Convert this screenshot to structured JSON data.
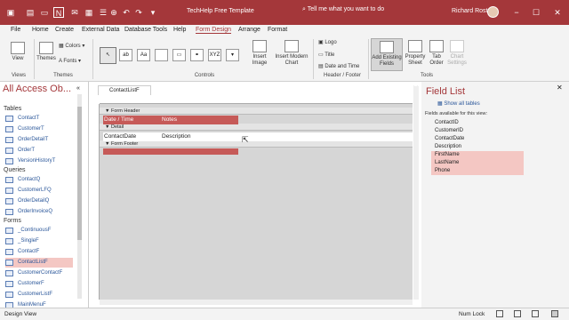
{
  "titlebar": {
    "title": "TechHelp Free Template",
    "search": "Tell me what you want to do",
    "user": "Richard Rost"
  },
  "menu": [
    "File",
    "Home",
    "Create",
    "External Data",
    "Database Tools",
    "Help",
    "Form Design",
    "Arrange",
    "Format"
  ],
  "ribbon": {
    "view": "View",
    "themes": "Themes",
    "colors": "Colors",
    "fonts": "Fonts",
    "insert_image": "Insert Image",
    "insert_chart": "Insert Modern Chart",
    "logo": "Logo",
    "title": "Title",
    "datetime": "Date and Time",
    "add_fields": "Add Existing Fields",
    "property_sheet": "Property Sheet",
    "tab_order": "Tab Order",
    "chart_settings": "Chart Settings",
    "groups": {
      "views": "Views",
      "themes": "Themes",
      "controls": "Controls",
      "header_footer": "Header / Footer",
      "tools": "Tools"
    }
  },
  "nav": {
    "title": "All Access Ob...",
    "tables_hdr": "Tables",
    "tables": [
      "ContactT",
      "CustomerT",
      "OrderDetailT",
      "OrderT",
      "VersionHistoryT"
    ],
    "queries_hdr": "Queries",
    "queries": [
      "ContactQ",
      "CustomerLFQ",
      "OrderDetailQ",
      "OrderInvoiceQ"
    ],
    "forms_hdr": "Forms",
    "forms": [
      "_ContinuousF",
      "_SingleF",
      "ContactF",
      "ContactListF",
      "CustomerContactF",
      "CustomerF",
      "CustomerListF",
      "MainMenuF"
    ]
  },
  "doc": {
    "tab": "ContactListF",
    "form_header": "Form Header",
    "detail": "Detail",
    "form_footer": "Form Footer",
    "hdr1": "Date / Time",
    "hdr2": "Notes",
    "fld1": "ContactDate",
    "fld2": "Description"
  },
  "fieldlist": {
    "title": "Field List",
    "show_all": "Show all tables",
    "sub": "Fields available for this view:",
    "fields": [
      "ContactID",
      "CustomerID",
      "ContactDate",
      "Description",
      "FirstName",
      "LastName",
      "Phone"
    ]
  },
  "status": {
    "left": "Design View",
    "numlock": "Num Lock"
  }
}
